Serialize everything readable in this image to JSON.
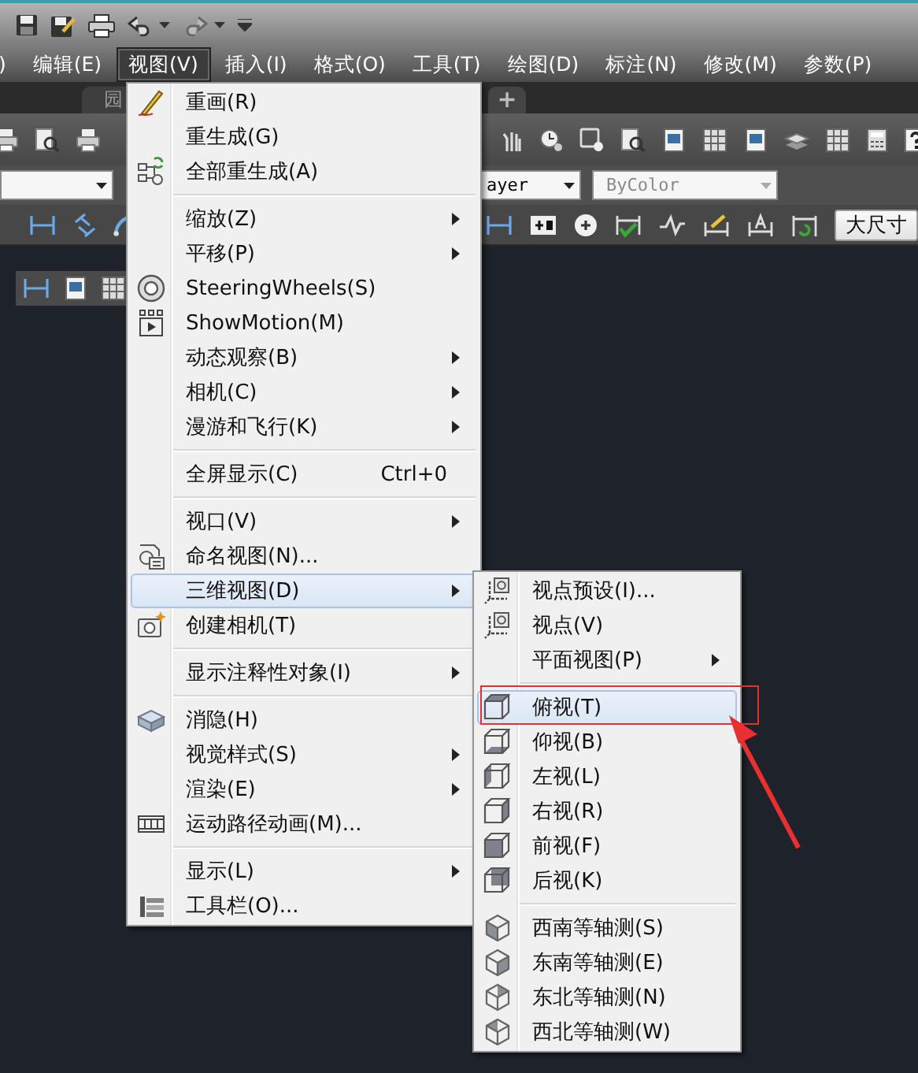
{
  "menu_bar": [
    {
      "label": ")",
      "selected": false
    },
    {
      "label": "编辑(E)",
      "selected": false
    },
    {
      "label": "视图(V)",
      "selected": true
    },
    {
      "label": "插入(I)",
      "selected": false
    },
    {
      "label": "格式(O)",
      "selected": false
    },
    {
      "label": "工具(T)",
      "selected": false
    },
    {
      "label": "绘图(D)",
      "selected": false
    },
    {
      "label": "标注(N)",
      "selected": false
    },
    {
      "label": "修改(M)",
      "selected": false
    },
    {
      "label": "参数(P)",
      "selected": false
    }
  ],
  "tabs": [
    {
      "label": "园"
    }
  ],
  "new_tab_button": "+",
  "layer_combo": {
    "value": "ayer"
  },
  "color_combo": {
    "value": "ByColor",
    "disabled": true
  },
  "dim_style_button": "大尺寸",
  "view_menu": {
    "items": [
      {
        "kind": "item",
        "label": "重画(R)",
        "submenu": false,
        "selected": false
      },
      {
        "kind": "item",
        "label": "重生成(G)",
        "submenu": false,
        "selected": false
      },
      {
        "kind": "item",
        "label": "全部重生成(A)",
        "submenu": false,
        "selected": false
      },
      {
        "kind": "separator"
      },
      {
        "kind": "item",
        "label": "缩放(Z)",
        "submenu": true,
        "selected": false
      },
      {
        "kind": "item",
        "label": "平移(P)",
        "submenu": true,
        "selected": false
      },
      {
        "kind": "item",
        "label": "SteeringWheels(S)",
        "submenu": false,
        "selected": false
      },
      {
        "kind": "item",
        "label": "ShowMotion(M)",
        "submenu": false,
        "selected": false
      },
      {
        "kind": "item",
        "label": "动态观察(B)",
        "submenu": true,
        "selected": false
      },
      {
        "kind": "item",
        "label": "相机(C)",
        "submenu": true,
        "selected": false
      },
      {
        "kind": "item",
        "label": "漫游和飞行(K)",
        "submenu": true,
        "selected": false
      },
      {
        "kind": "separator"
      },
      {
        "kind": "item",
        "label": "全屏显示(C)",
        "shortcut": "Ctrl+0",
        "submenu": false,
        "selected": false
      },
      {
        "kind": "separator"
      },
      {
        "kind": "item",
        "label": "视口(V)",
        "submenu": true,
        "selected": false
      },
      {
        "kind": "item",
        "label": "命名视图(N)...",
        "submenu": false,
        "selected": false
      },
      {
        "kind": "item",
        "label": "三维视图(D)",
        "submenu": true,
        "selected": true
      },
      {
        "kind": "item",
        "label": "创建相机(T)",
        "submenu": false,
        "selected": false
      },
      {
        "kind": "separator"
      },
      {
        "kind": "item",
        "label": "显示注释性对象(I)",
        "submenu": true,
        "selected": false
      },
      {
        "kind": "separator"
      },
      {
        "kind": "item",
        "label": "消隐(H)",
        "submenu": false,
        "selected": false
      },
      {
        "kind": "item",
        "label": "视觉样式(S)",
        "submenu": true,
        "selected": false
      },
      {
        "kind": "item",
        "label": "渲染(E)",
        "submenu": true,
        "selected": false
      },
      {
        "kind": "item",
        "label": "运动路径动画(M)...",
        "submenu": false,
        "selected": false
      },
      {
        "kind": "separator"
      },
      {
        "kind": "item",
        "label": "显示(L)",
        "submenu": true,
        "selected": false
      },
      {
        "kind": "item",
        "label": "工具栏(O)...",
        "submenu": false,
        "selected": false
      }
    ]
  },
  "view_3d_submenu": {
    "items": [
      {
        "kind": "item",
        "label": "视点预设(I)...",
        "submenu": false,
        "selected": false
      },
      {
        "kind": "item",
        "label": "视点(V)",
        "submenu": false,
        "selected": false
      },
      {
        "kind": "item",
        "label": "平面视图(P)",
        "submenu": true,
        "selected": false
      },
      {
        "kind": "separator"
      },
      {
        "kind": "item",
        "label": "俯视(T)",
        "submenu": false,
        "selected": true
      },
      {
        "kind": "item",
        "label": "仰视(B)",
        "submenu": false,
        "selected": false
      },
      {
        "kind": "item",
        "label": "左视(L)",
        "submenu": false,
        "selected": false
      },
      {
        "kind": "item",
        "label": "右视(R)",
        "submenu": false,
        "selected": false
      },
      {
        "kind": "item",
        "label": "前视(F)",
        "submenu": false,
        "selected": false
      },
      {
        "kind": "item",
        "label": "后视(K)",
        "submenu": false,
        "selected": false
      },
      {
        "kind": "separator"
      },
      {
        "kind": "item",
        "label": "西南等轴测(S)",
        "submenu": false,
        "selected": false
      },
      {
        "kind": "item",
        "label": "东南等轴测(E)",
        "submenu": false,
        "selected": false
      },
      {
        "kind": "item",
        "label": "东北等轴测(N)",
        "submenu": false,
        "selected": false
      },
      {
        "kind": "item",
        "label": "西北等轴测(W)",
        "submenu": false,
        "selected": false
      }
    ]
  }
}
